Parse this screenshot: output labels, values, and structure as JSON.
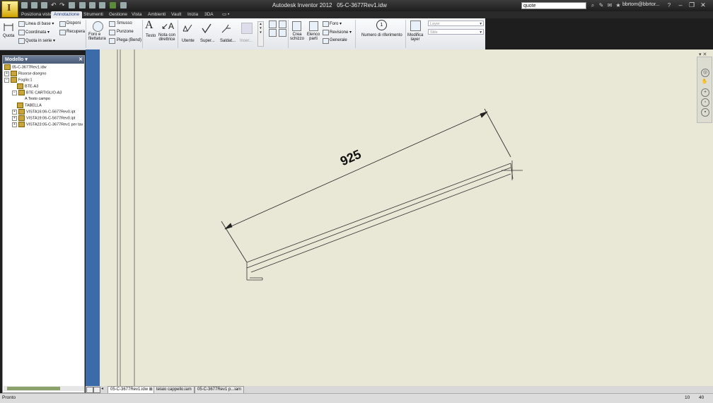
{
  "titlebar": {
    "app": "Autodesk Inventor 2012",
    "document": "05-C-3677Rev1.idw",
    "search_value": "quote",
    "user": "bbrtom@bbrtor..."
  },
  "tabs": [
    "Posiziona viste",
    "Annotazione",
    "Strumenti",
    "Gestione",
    "Vista",
    "Ambienti",
    "Vault",
    "Inizia",
    "3DA",
    "▭ •"
  ],
  "ribbon": {
    "quota": "Quota",
    "linea_di_base": "Linea di base",
    "coordinata": "Coordinata",
    "quota_in_serie": "Quota in serie",
    "disponi": "Disponi",
    "recupera": "Recupera",
    "foro_filettatura": "Foro e filettatura",
    "smusso": "Smusso",
    "punzone": "Punzone",
    "piega": "Piega (Bend)",
    "testo": "Testo",
    "nota_con_direttrice": "Nota con direttrice",
    "utente": "Utente",
    "super": "Super...",
    "saldat": "Saldat...",
    "inser": "Inser...",
    "crea_schizzo": "Crea schizzo",
    "elenco_parti": "Elenco parti",
    "foro": "Foro",
    "revisione": "Revisione",
    "generale": "Generale",
    "numero_riferimento": "Numero di riferimento",
    "modifica_layer": "Modifica layer",
    "layer_placeholder": "Layer",
    "stile_placeholder": "Stile"
  },
  "model": {
    "title": "Modello",
    "items": [
      {
        "label": "05-C-3677Rev1.idw",
        "level": 0
      },
      {
        "label": "Risorse disegno",
        "level": 1
      },
      {
        "label": "Foglio:1",
        "level": 1
      },
      {
        "label": "BTE-A3",
        "level": 2
      },
      {
        "label": "BTE CARTIGLIO-A3",
        "level": 2
      },
      {
        "label": "Testo campo",
        "level": 3
      },
      {
        "label": "TABELLA",
        "level": 2
      },
      {
        "label": "VISTA16:06-C-5677Rev0.ipt",
        "level": 2
      },
      {
        "label": "VISTA19:06-C-5677Rev0.ipt",
        "level": 2
      },
      {
        "label": "VISTA23:05-C-3677Rev1 per tav",
        "level": 2
      }
    ]
  },
  "drawing": {
    "dimension": "925"
  },
  "doc_tabs": [
    "05-C-3677Rev1.idw",
    "telaio cappello.iam",
    "05-C-3677Rev1 p...iam"
  ],
  "status": {
    "text": "Pronto",
    "num1": "10",
    "num2": "40"
  }
}
